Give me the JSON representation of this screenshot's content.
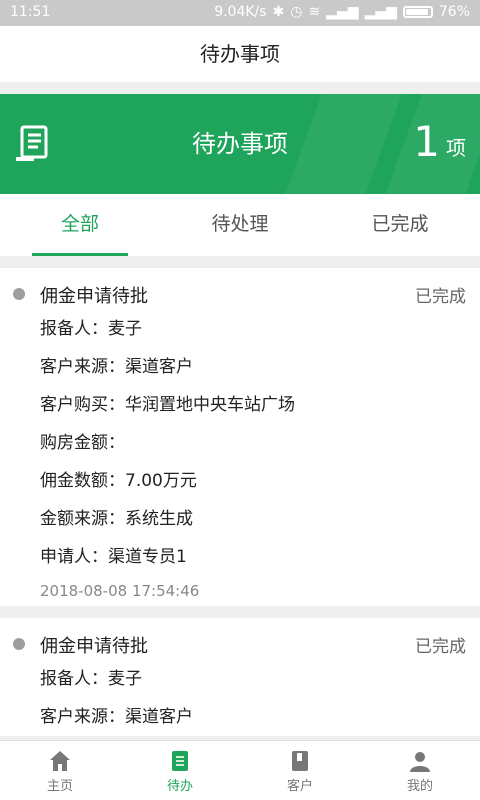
{
  "status_bar": {
    "time": "11:51",
    "net_speed": "9.04K/s",
    "battery": "76%"
  },
  "header": {
    "title": "待办事项"
  },
  "banner": {
    "title": "待办事项",
    "count": "1",
    "unit": "项",
    "color": "#1fa45b"
  },
  "tabs": [
    {
      "label": "全部",
      "active": true
    },
    {
      "label": "待处理",
      "active": false
    },
    {
      "label": "已完成",
      "active": false
    }
  ],
  "cards": [
    {
      "title": "佣金申请待批",
      "status": "已完成",
      "rows": [
        "报备人：麦子",
        "客户来源：渠道客户",
        "客户购买：华润置地中央车站广场",
        "购房金额：",
        "佣金数额：7.00万元",
        "金额来源：系统生成",
        "申请人：渠道专员1"
      ],
      "timestamp": "2018-08-08 17:54:46"
    },
    {
      "title": "佣金申请待批",
      "status": "已完成",
      "rows": [
        "报备人：麦子",
        "客户来源：渠道客户"
      ],
      "timestamp": ""
    }
  ],
  "tabbar": [
    {
      "label": "主页",
      "icon": "home-icon",
      "active": false
    },
    {
      "label": "待办",
      "icon": "todo-icon",
      "active": true
    },
    {
      "label": "客户",
      "icon": "book-icon",
      "active": false
    },
    {
      "label": "我的",
      "icon": "person-icon",
      "active": false
    }
  ]
}
